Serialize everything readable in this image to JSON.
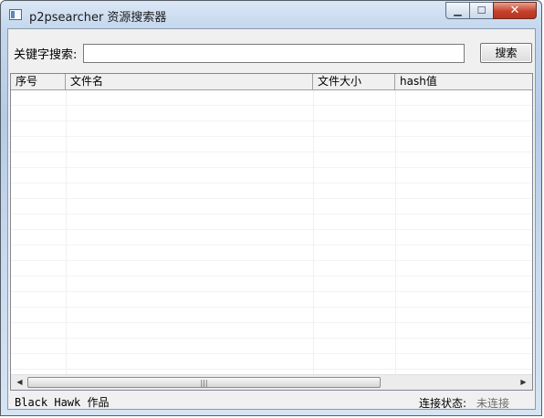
{
  "window": {
    "title": "p2psearcher 资源搜索器",
    "buttons": {
      "minimize_icon": "minimize-icon",
      "maximize_icon": "maximize-icon",
      "close_icon": "close-icon",
      "close_glyph": "✕",
      "min_glyph": "▁",
      "max_glyph": "☐"
    }
  },
  "search": {
    "label": "关键字搜索:",
    "value": "",
    "button_label": "搜索"
  },
  "table": {
    "columns": [
      "序号",
      "文件名",
      "文件大小",
      "hash值"
    ],
    "rows": []
  },
  "scrollbar": {
    "left_arrow": "◀",
    "right_arrow": "▶",
    "grip": "|||"
  },
  "status": {
    "author": "Black Hawk 作品",
    "connection_label": "连接状态:",
    "connection_value": "未连接"
  },
  "colors": {
    "close_button": "#c5402a",
    "window_frame": "#c4d7ee"
  }
}
